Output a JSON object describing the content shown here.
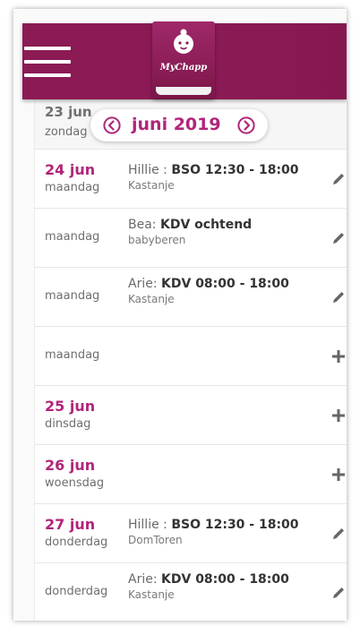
{
  "app": {
    "logo_text": "MyChapp"
  },
  "header": {
    "menu_icon": "hamburger-menu-icon"
  },
  "month_nav": {
    "label": "juni 2019",
    "prev_icon": "chevron-left-circle-icon",
    "next_icon": "chevron-right-circle-icon"
  },
  "colors": {
    "brand": "#8c1a55",
    "accent": "#b0257a"
  },
  "days": [
    {
      "date": "23 jun",
      "weekday": "zondag"
    },
    {
      "date": "24 jun",
      "weekday": "maandag",
      "person": "Hillie",
      "sep": " : ",
      "shift": "BSO 12:30 - 18:00",
      "location": "Kastanje",
      "action": "edit"
    },
    {
      "date": "",
      "weekday": "maandag",
      "person": "Bea",
      "sep": ": ",
      "shift": "KDV ochtend",
      "location": "babyberen",
      "action": "edit"
    },
    {
      "date": "",
      "weekday": "maandag",
      "person": "Arie",
      "sep": ": ",
      "shift": "KDV 08:00 - 18:00",
      "location": "Kastanje",
      "action": "edit"
    },
    {
      "date": "",
      "weekday": "maandag",
      "action": "add"
    },
    {
      "date": "25 jun",
      "weekday": "dinsdag",
      "action": "add"
    },
    {
      "date": "26 jun",
      "weekday": "woensdag",
      "action": "add"
    },
    {
      "date": "27 jun",
      "weekday": "donderdag",
      "person": "Hillie",
      "sep": " : ",
      "shift": "BSO 12:30 - 18:00",
      "location": "DomToren",
      "action": "edit"
    },
    {
      "date": "",
      "weekday": "donderdag",
      "person": "Arie",
      "sep": ": ",
      "shift": "KDV 08:00 - 18:00",
      "location": "Kastanje",
      "action": "edit"
    }
  ]
}
